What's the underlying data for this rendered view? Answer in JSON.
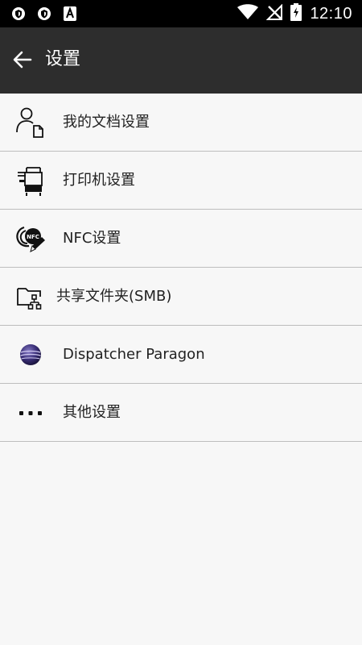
{
  "status_bar": {
    "time": "12:10",
    "left_icons": [
      "shield-icon",
      "shield-icon",
      "font-a-icon"
    ],
    "right_icons": [
      "wifi-icon",
      "no-signal-icon",
      "battery-charging-icon"
    ]
  },
  "app_bar": {
    "title": "设置",
    "back_icon": "arrow-left-icon"
  },
  "settings": [
    {
      "label": "我的文档设置",
      "icon": "user-document-icon"
    },
    {
      "label": "打印机设置",
      "icon": "printer-icon"
    },
    {
      "label": "NFC设置",
      "icon": "nfc-icon"
    },
    {
      "label": "共享文件夹(SMB)",
      "icon": "shared-folder-icon"
    },
    {
      "label": "Dispatcher Paragon",
      "icon": "dispatcher-paragon-logo"
    },
    {
      "label": "其他设置",
      "icon": "more-dots-icon"
    }
  ],
  "colors": {
    "status_bar": "#000000",
    "app_bar": "#2d2d2d",
    "background": "#f7f7f7",
    "divider": "#bdbdbd"
  }
}
